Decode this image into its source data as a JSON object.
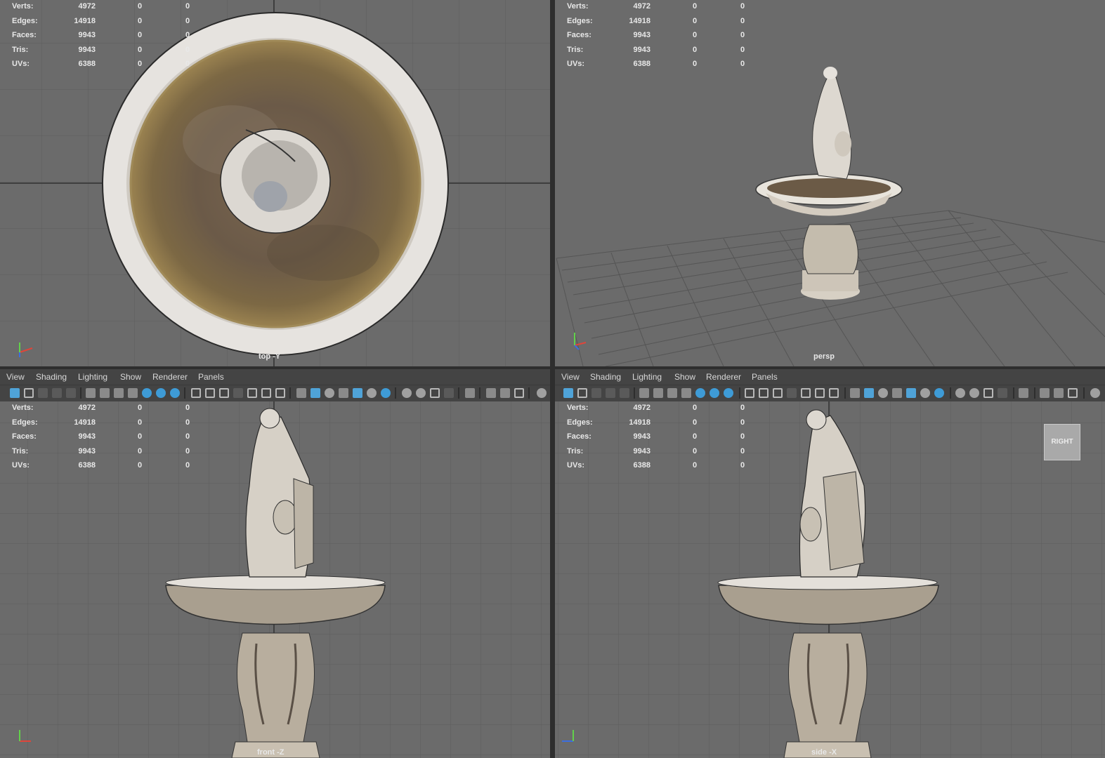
{
  "stats_labels": [
    "Verts:",
    "Edges:",
    "Faces:",
    "Tris:",
    "UVs:"
  ],
  "stats_values": [
    [
      "4972",
      "0",
      "0"
    ],
    [
      "14918",
      "0",
      "0"
    ],
    [
      "9943",
      "0",
      "0"
    ],
    [
      "9943",
      "0",
      "0"
    ],
    [
      "6388",
      "0",
      "0"
    ]
  ],
  "viewports": {
    "top": {
      "camera": "top -Y"
    },
    "persp": {
      "camera": "persp"
    },
    "front": {
      "camera": "front -Z"
    },
    "side": {
      "camera": "side -X"
    }
  },
  "menu": [
    "View",
    "Shading",
    "Lighting",
    "Show",
    "Renderer",
    "Panels"
  ],
  "viewcube_label": "RIGHT",
  "axis_labels": {
    "x": "x",
    "y": "y",
    "z": "z"
  },
  "colors": {
    "viewport_bg": "#6b6b6b",
    "grid": "#5a5a5a",
    "toolbar_bg": "#444444",
    "accent": "#4fa3d8",
    "axis_x": "#e0453a",
    "axis_y": "#62d14b",
    "axis_z": "#3c6ee0"
  },
  "icons": [
    "select-icon",
    "camera-icon",
    "grid-icon",
    "wireframe-icon",
    "smooth-shade-icon",
    "texture-icon",
    "light-icon",
    "isolate-icon"
  ]
}
